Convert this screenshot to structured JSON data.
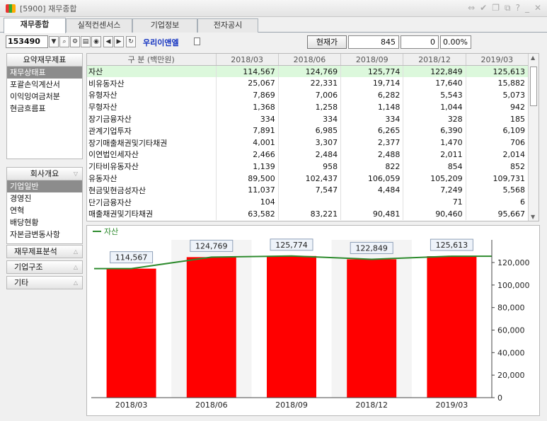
{
  "window": {
    "title": "[5900] 재무종합"
  },
  "tabs": [
    {
      "label": "재무종합"
    },
    {
      "label": "실적컨센서스"
    },
    {
      "label": "기업정보"
    },
    {
      "label": "전자공시"
    }
  ],
  "toolbar": {
    "stock_code": "153490",
    "company_name": "우리이앤엘",
    "price_button": "현재가",
    "price": "845",
    "change": "0",
    "change_rate": "0.00%"
  },
  "left_menu": {
    "summary": {
      "header": "요약재무제표",
      "items": [
        {
          "label": "재무상태표"
        },
        {
          "label": "포괄손익계산서"
        },
        {
          "label": "이익잉여금처분"
        },
        {
          "label": "현금흐름표"
        }
      ]
    },
    "company": {
      "header": "회사개요",
      "items": [
        {
          "label": "기업일반"
        },
        {
          "label": "경영진"
        },
        {
          "label": "연혁"
        },
        {
          "label": "배당현황"
        },
        {
          "label": "자본금변동사항"
        }
      ]
    },
    "sections": [
      {
        "label": "재무제표분석"
      },
      {
        "label": "기업구조"
      },
      {
        "label": "기타"
      }
    ]
  },
  "table": {
    "header_label": "구   분  (백만원)",
    "periods": [
      "2018/03",
      "2018/06",
      "2018/09",
      "2018/12",
      "2019/03"
    ],
    "rows": [
      {
        "label": "자산",
        "values": [
          "114,567",
          "124,769",
          "125,774",
          "122,849",
          "125,613"
        ]
      },
      {
        "label": "비유동자산",
        "values": [
          "25,067",
          "22,331",
          "19,714",
          "17,640",
          "15,882"
        ]
      },
      {
        "label": "유형자산",
        "values": [
          "7,869",
          "7,006",
          "6,282",
          "5,543",
          "5,073"
        ]
      },
      {
        "label": "무형자산",
        "values": [
          "1,368",
          "1,258",
          "1,148",
          "1,044",
          "942"
        ]
      },
      {
        "label": "장기금융자산",
        "values": [
          "334",
          "334",
          "334",
          "328",
          "185"
        ]
      },
      {
        "label": "관계기업투자",
        "values": [
          "7,891",
          "6,985",
          "6,265",
          "6,390",
          "6,109"
        ]
      },
      {
        "label": "장기매출채권및기타채권",
        "values": [
          "4,001",
          "3,307",
          "2,377",
          "1,470",
          "706"
        ]
      },
      {
        "label": "이연법인세자산",
        "values": [
          "2,466",
          "2,484",
          "2,488",
          "2,011",
          "2,014"
        ]
      },
      {
        "label": "기타비유동자산",
        "values": [
          "1,139",
          "958",
          "822",
          "854",
          "852"
        ]
      },
      {
        "label": "유동자산",
        "values": [
          "89,500",
          "102,437",
          "106,059",
          "105,209",
          "109,731"
        ]
      },
      {
        "label": "현금및현금성자산",
        "values": [
          "11,037",
          "7,547",
          "4,484",
          "7,249",
          "5,568"
        ]
      },
      {
        "label": "단기금융자산",
        "values": [
          "104",
          "",
          "",
          "71",
          "6"
        ]
      },
      {
        "label": "매출채권및기타채권",
        "values": [
          "63,582",
          "83,221",
          "90,481",
          "90,460",
          "95,667"
        ]
      }
    ]
  },
  "chart_data": {
    "type": "bar",
    "legend": "자산",
    "categories": [
      "2018/03",
      "2018/06",
      "2018/09",
      "2018/12",
      "2019/03"
    ],
    "values": [
      114567,
      124769,
      125774,
      122849,
      125613
    ],
    "value_labels": [
      "114,567",
      "124,769",
      "125,774",
      "122,849",
      "125,613"
    ],
    "ylim": [
      0,
      140000
    ],
    "yticks": [
      0,
      20000,
      40000,
      60000,
      80000,
      100000,
      120000
    ],
    "ytick_labels": [
      "0",
      "20,000",
      "40,000",
      "60,000",
      "80,000",
      "100,000",
      "120,000"
    ],
    "bar_color": "#ff0000",
    "line_color": "#2e8b2e"
  }
}
